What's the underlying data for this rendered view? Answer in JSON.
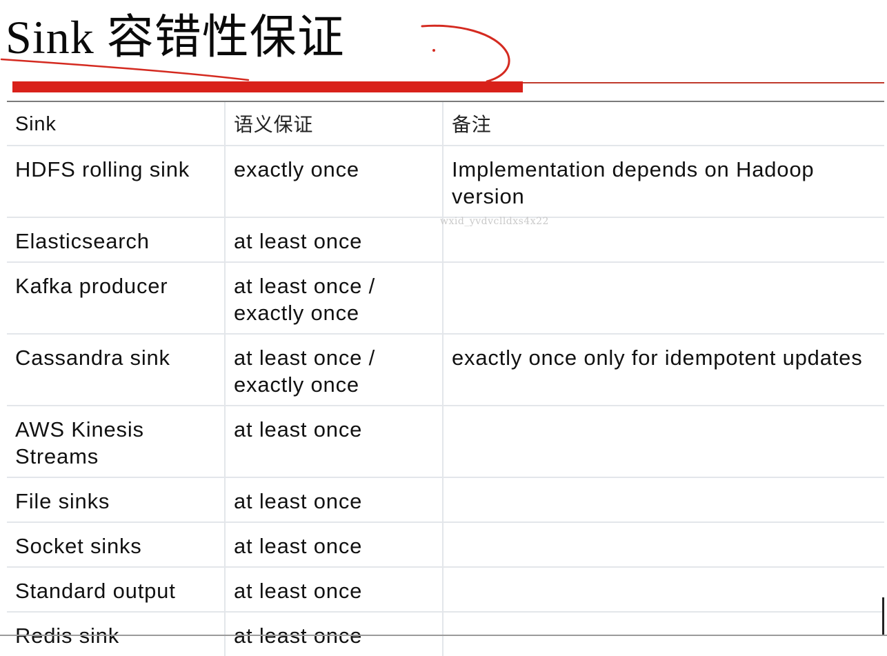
{
  "slide": {
    "title": "Sink 容错性保证",
    "watermark": "wxid_yvdvclldxs4x22"
  },
  "table": {
    "headers": [
      "Sink",
      "语义保证",
      "备注"
    ],
    "rows": [
      [
        "HDFS rolling sink",
        "exactly once",
        "Implementation depends on Hadoop version"
      ],
      [
        "Elasticsearch",
        "at least once",
        ""
      ],
      [
        "Kafka producer",
        "at least once / exactly once",
        ""
      ],
      [
        "Cassandra sink",
        "at least once / exactly once",
        "exactly once only for idempotent updates"
      ],
      [
        "AWS Kinesis Streams",
        "at least once",
        ""
      ],
      [
        "File sinks",
        "at least once",
        ""
      ],
      [
        "Socket sinks",
        "at least once",
        ""
      ],
      [
        "Standard output",
        "at least once",
        ""
      ],
      [
        "Redis sink",
        "at least once",
        ""
      ]
    ]
  },
  "colors": {
    "accent_red": "#d9211a",
    "annotation_red": "#d42a20",
    "grid_line": "#e3e6ea"
  }
}
